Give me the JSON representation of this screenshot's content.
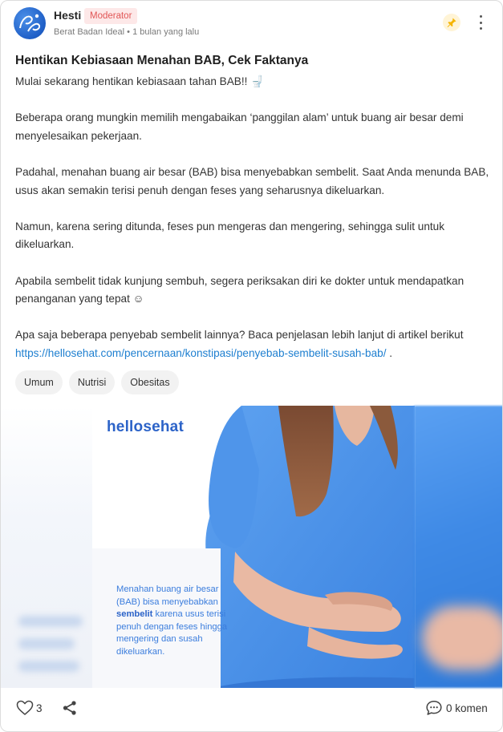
{
  "post": {
    "author": "Hesti",
    "role_badge": "Moderator",
    "group": "Berat Badan Ideal",
    "separator": "•",
    "time": "1 bulan yang lalu",
    "title": "Hentikan Kebiasaan Menahan BAB, Cek Faktanya",
    "intro": "Mulai sekarang hentikan kebiasaan tahan BAB!! 🚽",
    "paragraphs": [
      "Beberapa orang mungkin memilih mengabaikan ‘panggilan alam’ untuk buang air besar demi menyelesaikan pekerjaan.",
      "Padahal, menahan buang air besar (BAB) bisa menyebabkan sembelit. Saat Anda menunda BAB, usus akan semakin terisi penuh dengan feses yang seharusnya dikeluarkan.",
      "Namun, karena sering ditunda, feses pun mengeras dan mengering, sehingga sulit untuk dikeluarkan.",
      "Apabila sembelit tidak kunjung sembuh, segera periksakan diri ke dokter untuk mendapatkan penanganan yang tepat ☺"
    ],
    "closing_text": "Apa saja beberapa penyebab sembelit lainnya? Baca penjelasan lebih lanjut di artikel berikut ",
    "link": "https://hellosehat.com/pencernaan/konstipasi/penyebab-sembelit-susah-bab/",
    "closing_end": " ."
  },
  "tags": [
    "Umum",
    "Nutrisi",
    "Obesitas"
  ],
  "image": {
    "brand": "hellosehat",
    "caption_1": "Menahan buang air besar (BAB) bisa menyebabkan ",
    "caption_bold": "sembelit",
    "caption_2": " karena usus terisi penuh dengan feses hingga mengering dan susah dikeluarkan."
  },
  "footer": {
    "like_count": "3",
    "comment_label": "0 komen"
  },
  "icons": {
    "pin": "pin-icon",
    "more": "more-icon",
    "like": "heart-icon",
    "share": "share-icon",
    "comment": "comment-icon"
  },
  "colors": {
    "badge_bg": "#fde8e8",
    "badge_text": "#e15656",
    "link": "#1e7fd0",
    "brand_blue": "#2c63c8",
    "shirt_blue": "#4a90e8"
  }
}
